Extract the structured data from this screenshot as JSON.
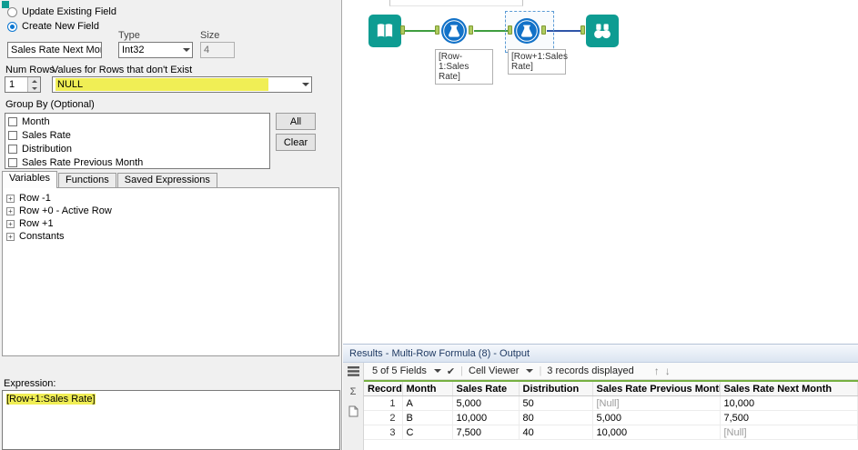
{
  "colors": {
    "highlight": "#f0ee55",
    "teal": "#0e9c92",
    "tool_blue": "#1372c8",
    "connection_green": "#3f9e3f",
    "connection_blue": "#2f55a8",
    "anchor_green": "#aecb5f",
    "results_green_line": "#76b041",
    "header_blue_text": "#1f3a63"
  },
  "config": {
    "radio_update_label": "Update Existing Field",
    "radio_create_label": "Create New  Field",
    "field_name_value": "Sales Rate Next Month",
    "type_label": "Type",
    "type_value": "Int32",
    "size_label": "Size",
    "size_value": "4",
    "num_rows_label": "Num Rows",
    "num_rows_value": "1",
    "values_label": "Values for Rows that don't Exist",
    "values_value": "NULL",
    "group_by_label": "Group By (Optional)",
    "group_by_items": [
      "Month",
      "Sales Rate",
      "Distribution",
      "Sales Rate Previous Month"
    ],
    "all_button_label": "All",
    "clear_button_label": "Clear",
    "tabs": [
      "Variables",
      "Functions",
      "Saved Expressions"
    ],
    "tree_items": [
      "Row -1",
      "Row +0 - Active Row",
      "Row +1",
      "Constants"
    ],
    "expression_label": "Expression:",
    "expression_value": "[Row+1:Sales Rate]"
  },
  "canvas": {
    "tool1_caption": "[Row-1:Sales Rate]",
    "tool2_caption": "[Row+1:Sales Rate]"
  },
  "results": {
    "title": "Results - Multi-Row Formula (8) - Output",
    "fields_summary": "5 of 5 Fields",
    "cell_viewer_label": "Cell Viewer",
    "records_label": "3 records displayed",
    "null_marker": "[Null]",
    "columns": [
      "Record",
      "Month",
      "Sales Rate",
      "Distribution",
      "Sales Rate Previous Month",
      "Sales Rate Next Month"
    ],
    "rows": [
      [
        "1",
        "A",
        "5,000",
        "50",
        "[Null]",
        "10,000"
      ],
      [
        "2",
        "B",
        "10,000",
        "80",
        "5,000",
        "7,500"
      ],
      [
        "3",
        "C",
        "7,500",
        "40",
        "10,000",
        "[Null]"
      ]
    ]
  }
}
